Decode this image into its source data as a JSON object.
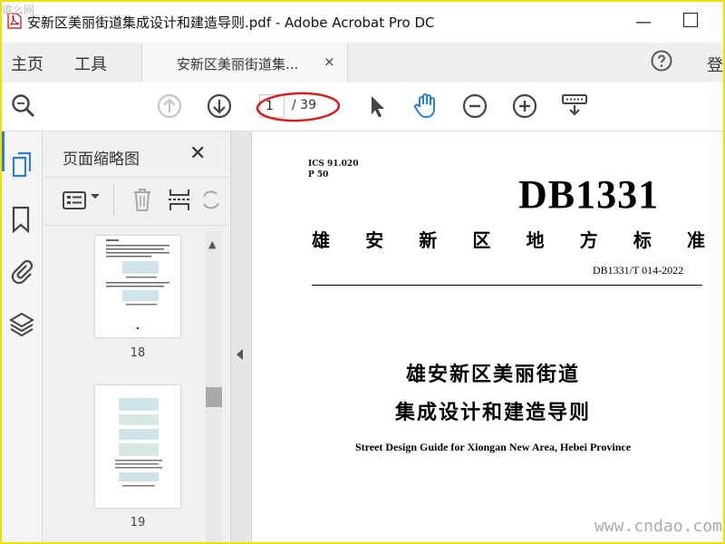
{
  "window": {
    "title": "安新区美丽街道集成设计和建造导则.pdf - Adobe Acrobat Pro DC",
    "corner_logo": "谁么网"
  },
  "menu": {
    "home": "主页",
    "tools": "工具",
    "signin": "登"
  },
  "doc_tab": {
    "label": "安新区美丽街道集...",
    "close": "×"
  },
  "toolbar": {
    "page_current": "1",
    "page_total": "/ 39",
    "highlight_color": "#d42020",
    "active_tool": "hand"
  },
  "icons": {
    "search": "search-zoom-icon",
    "prev_page": "arrow-up-circle-icon",
    "next_page": "arrow-down-circle-icon",
    "select": "cursor-arrow-icon",
    "hand": "hand-icon",
    "zoom_out": "minus-circle-icon",
    "zoom_in": "plus-circle-icon",
    "keyboard": "keyboard-icon"
  },
  "thumb_panel": {
    "title": "页面缩略图",
    "pages": [
      {
        "label": "18"
      },
      {
        "label": "19"
      }
    ]
  },
  "document": {
    "ics": "ICS 91.020",
    "p": "P 50",
    "code": "DB1331",
    "standard_chars": [
      "雄",
      "安",
      "新",
      "区",
      "地",
      "方",
      "标",
      "准"
    ],
    "number": "DB1331/T 014-2022",
    "title_line1": "雄安新区美丽街道",
    "title_line2": "集成设计和建造导则",
    "subtitle": "Street Design Guide for Xiongan New Area, Hebei Province"
  },
  "watermark": "www.cndao.com",
  "colors": {
    "accent_blue": "#2f7fd0",
    "frame_yellow": "#f0e000"
  }
}
